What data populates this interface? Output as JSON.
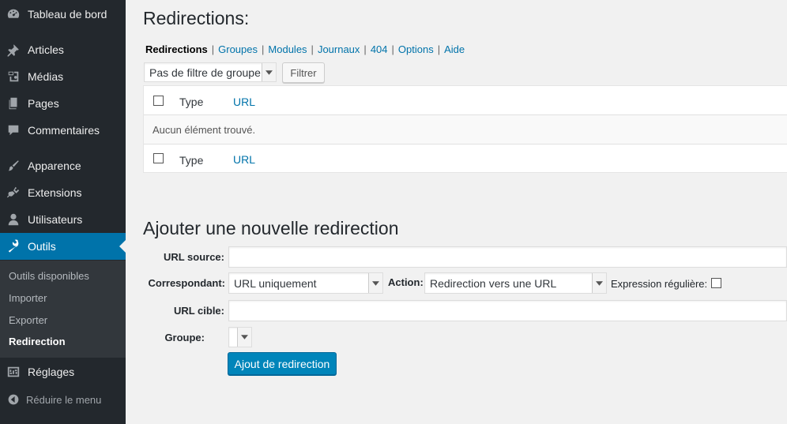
{
  "sidebar": {
    "items": [
      {
        "label": "Tableau de bord",
        "icon": "dashboard-icon"
      },
      {
        "label": "Articles",
        "icon": "pushpin-icon"
      },
      {
        "label": "Médias",
        "icon": "media-icon"
      },
      {
        "label": "Pages",
        "icon": "page-icon"
      },
      {
        "label": "Commentaires",
        "icon": "comment-icon"
      },
      {
        "label": "Apparence",
        "icon": "brush-icon"
      },
      {
        "label": "Extensions",
        "icon": "plugin-icon"
      },
      {
        "label": "Utilisateurs",
        "icon": "user-icon"
      },
      {
        "label": "Outils",
        "icon": "wrench-icon"
      },
      {
        "label": "Réglages",
        "icon": "settings-icon"
      }
    ],
    "submenu": [
      "Outils disponibles",
      "Importer",
      "Exporter",
      "Redirection"
    ],
    "collapse_label": "Réduire le menu"
  },
  "page": {
    "title": "Redirections:",
    "tabs": [
      "Redirections",
      "Groupes",
      "Modules",
      "Journaux",
      "404",
      "Options",
      "Aide"
    ],
    "tabs_separator": "|",
    "filter_select": "Pas de filtre de groupe",
    "filter_button": "Filtrer"
  },
  "table": {
    "col_type": "Type",
    "col_url": "URL",
    "empty_message": "Aucun élément trouvé."
  },
  "add_form": {
    "title": "Ajouter une nouvelle redirection",
    "source_label": "URL source:",
    "source_value": "",
    "match_label": "Correspondant:",
    "match_value": "URL uniquement",
    "action_label": "Action:",
    "action_value": "Redirection vers une URL",
    "regex_label": "Expression régulière:",
    "target_label": "URL cible:",
    "target_value": "",
    "group_label": "Groupe:",
    "group_value": "",
    "submit_label": "Ajout de redirection"
  },
  "colors": {
    "sidebar_bg": "#23282d",
    "active_bg": "#0073aa",
    "link": "#0073aa",
    "primary_button": "#0085ba"
  }
}
